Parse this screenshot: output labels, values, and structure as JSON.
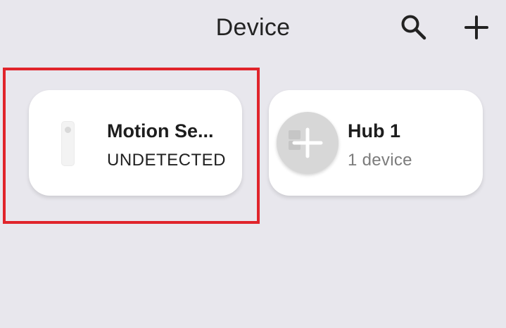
{
  "header": {
    "title": "Device",
    "search_icon": "search-icon",
    "add_icon": "plus-icon"
  },
  "devices": [
    {
      "name": "Motion Se...",
      "status": "UNDETECTED",
      "icon": "motion-sensor-icon"
    },
    {
      "name": "Hub 1",
      "subtitle": "1 device",
      "icon": "hub-icon"
    }
  ],
  "colors": {
    "background": "#e8e7ed",
    "card": "#ffffff",
    "highlight": "#e0242b",
    "secondary_text": "#7c7c7c"
  }
}
